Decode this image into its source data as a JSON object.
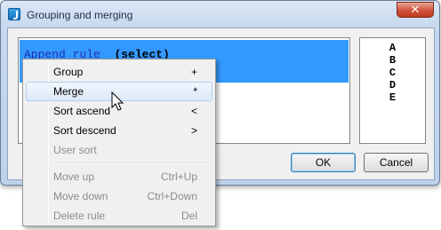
{
  "window": {
    "title": "Grouping and merging",
    "close_glyph": "✕"
  },
  "rule_list": {
    "keyword": "Append rule",
    "arg": "(select)"
  },
  "letters": [
    "A",
    "B",
    "C",
    "D",
    "E"
  ],
  "buttons": {
    "ok": "OK",
    "cancel": "Cancel"
  },
  "menu": {
    "items": [
      {
        "label": "Group",
        "shortcut": "+",
        "enabled": true
      },
      {
        "label": "Merge",
        "shortcut": "*",
        "enabled": true,
        "highlighted": true
      },
      {
        "label": "Sort ascend",
        "shortcut": "<",
        "enabled": true
      },
      {
        "label": "Sort descend",
        "shortcut": ">",
        "enabled": true
      },
      {
        "label": "User sort",
        "shortcut": "",
        "enabled": false
      },
      {
        "label": "Move up",
        "shortcut": "Ctrl+Up",
        "enabled": false
      },
      {
        "label": "Move down",
        "shortcut": "Ctrl+Down",
        "enabled": false
      },
      {
        "label": "Delete rule",
        "shortcut": "Del",
        "enabled": false
      }
    ]
  }
}
